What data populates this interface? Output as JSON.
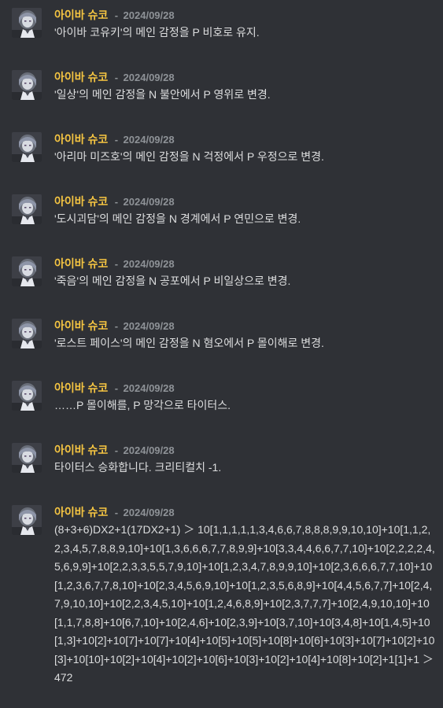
{
  "theme": {
    "background": "#2f3136",
    "author_color": "#f5c542",
    "text_color": "#dcddde",
    "timestamp_color": "#8e9297"
  },
  "messages": [
    {
      "author": "아이바 슈코",
      "separator": "-",
      "timestamp": "2024/09/28",
      "avatar_icon": "character-portrait-icon",
      "content": "'아이바 코유키'의 메인 감정을 P 비호로 유지."
    },
    {
      "author": "아이바 슈코",
      "separator": "-",
      "timestamp": "2024/09/28",
      "avatar_icon": "character-portrait-icon",
      "content": "'일상'의 메인 감정을 N 불안에서 P 영위로 변경."
    },
    {
      "author": "아이바 슈코",
      "separator": "-",
      "timestamp": "2024/09/28",
      "avatar_icon": "character-portrait-icon",
      "content": "'아리마 미즈호'의 메인 감정을 N 걱정에서 P 우정으로 변경."
    },
    {
      "author": "아이바 슈코",
      "separator": "-",
      "timestamp": "2024/09/28",
      "avatar_icon": "character-portrait-icon",
      "content": "'도시괴담'의 메인 감정을 N 경계에서 P 연민으로 변경."
    },
    {
      "author": "아이바 슈코",
      "separator": "-",
      "timestamp": "2024/09/28",
      "avatar_icon": "character-portrait-icon",
      "content": "'죽음'의 메인 감정을 N 공포에서 P 비일상으로 변경."
    },
    {
      "author": "아이바 슈코",
      "separator": "-",
      "timestamp": "2024/09/28",
      "avatar_icon": "character-portrait-icon",
      "content": "'로스트 페이스'의 메인 감정을 N 혐오에서 P 몰이해로 변경."
    },
    {
      "author": "아이바 슈코",
      "separator": "-",
      "timestamp": "2024/09/28",
      "avatar_icon": "character-portrait-icon",
      "content": "……P 몰이해를, P 망각으로 타이터스."
    },
    {
      "author": "아이바 슈코",
      "separator": "-",
      "timestamp": "2024/09/28",
      "avatar_icon": "character-portrait-icon",
      "content": "타이터스 승화합니다. 크리티컬치 -1."
    },
    {
      "author": "아이바 슈코",
      "separator": "-",
      "timestamp": "2024/09/28",
      "avatar_icon": "character-portrait-icon",
      "content": "(8+3+6)DX2+1(17DX2+1) ＞ 10[1,1,1,1,1,3,4,6,6,7,8,8,8,9,9,10,10]+10[1,1,2,2,3,4,5,7,8,8,9,10]+10[1,3,6,6,6,7,7,8,9,9]+10[3,3,4,4,6,6,7,7,10]+10[2,2,2,2,4,5,6,9,9]+10[2,2,3,3,5,5,7,9,10]+10[1,2,3,4,7,8,9,9,10]+10[2,3,6,6,6,7,7,10]+10[1,2,3,6,7,7,8,10]+10[2,3,4,5,6,9,10]+10[1,2,3,5,6,8,9]+10[4,4,5,6,7,7]+10[2,4,7,9,10,10]+10[2,2,3,4,5,10]+10[1,2,4,6,8,9]+10[2,3,7,7,7]+10[2,4,9,10,10]+10[1,1,7,8,8]+10[6,7,10]+10[2,4,6]+10[2,3,9]+10[3,7,10]+10[3,4,8]+10[1,4,5]+10[1,3]+10[2]+10[7]+10[7]+10[4]+10[5]+10[5]+10[8]+10[6]+10[3]+10[7]+10[2]+10[3]+10[10]+10[2]+10[4]+10[2]+10[6]+10[3]+10[2]+10[4]+10[8]+10[2]+1[1]+1 ＞ 472"
    }
  ]
}
